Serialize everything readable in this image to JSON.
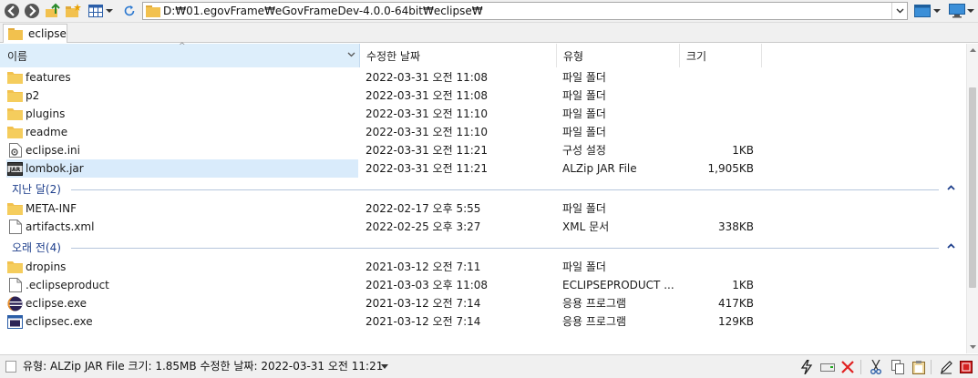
{
  "address": {
    "path": "D:₩01.egovFrame₩eGovFrameDev-4.0.0-64bit₩eclipse₩"
  },
  "tab": {
    "label": "eclipse"
  },
  "columns": {
    "name": "이름",
    "date": "수정한 날짜",
    "type": "유형",
    "size": "크기"
  },
  "groups": [
    {
      "label": ""
    },
    {
      "label": "지난 달(2)"
    },
    {
      "label": "오래 전(4)"
    }
  ],
  "files": [
    {
      "name": "features",
      "date": "2022-03-31 오전 11:08",
      "type": "파일 폴더",
      "size": "",
      "icon": "folder-icon"
    },
    {
      "name": "p2",
      "date": "2022-03-31 오전 11:08",
      "type": "파일 폴더",
      "size": "",
      "icon": "folder-icon"
    },
    {
      "name": "plugins",
      "date": "2022-03-31 오전 11:10",
      "type": "파일 폴더",
      "size": "",
      "icon": "folder-icon"
    },
    {
      "name": "readme",
      "date": "2022-03-31 오전 11:10",
      "type": "파일 폴더",
      "size": "",
      "icon": "folder-icon"
    },
    {
      "name": "eclipse.ini",
      "date": "2022-03-31 오전 11:21",
      "type": "구성 설정",
      "size": "1KB",
      "icon": "config-file-icon"
    },
    {
      "name": "lombok.jar",
      "date": "2022-03-31 오전 11:21",
      "type": "ALZip JAR File",
      "size": "1,905KB",
      "icon": "jar-file-icon"
    },
    {
      "name": "META-INF",
      "date": "2022-02-17 오후 5:55",
      "type": "파일 폴더",
      "size": "",
      "icon": "folder-icon"
    },
    {
      "name": "artifacts.xml",
      "date": "2022-02-25 오후 3:27",
      "type": "XML 문서",
      "size": "338KB",
      "icon": "document-icon"
    },
    {
      "name": "dropins",
      "date": "2021-03-12 오전 7:11",
      "type": "파일 폴더",
      "size": "",
      "icon": "folder-icon"
    },
    {
      "name": ".eclipseproduct",
      "date": "2021-03-03 오후 11:08",
      "type": "ECLIPSEPRODUCT ...",
      "size": "1KB",
      "icon": "document-icon"
    },
    {
      "name": "eclipse.exe",
      "date": "2021-03-12 오전 7:14",
      "type": "응용 프로그램",
      "size": "417KB",
      "icon": "eclipse-app-icon"
    },
    {
      "name": "eclipsec.exe",
      "date": "2021-03-12 오전 7:14",
      "type": "응용 프로그램",
      "size": "129KB",
      "icon": "console-app-icon"
    }
  ],
  "status": {
    "text": "유형: ALZip JAR File 크기: 1.85MB 수정한 날짜: 2022-03-31 오전 11:21"
  },
  "colors": {
    "selection": "#d9ebfb",
    "group_label": "#1e3f8c",
    "folder": "#f2c14e"
  }
}
